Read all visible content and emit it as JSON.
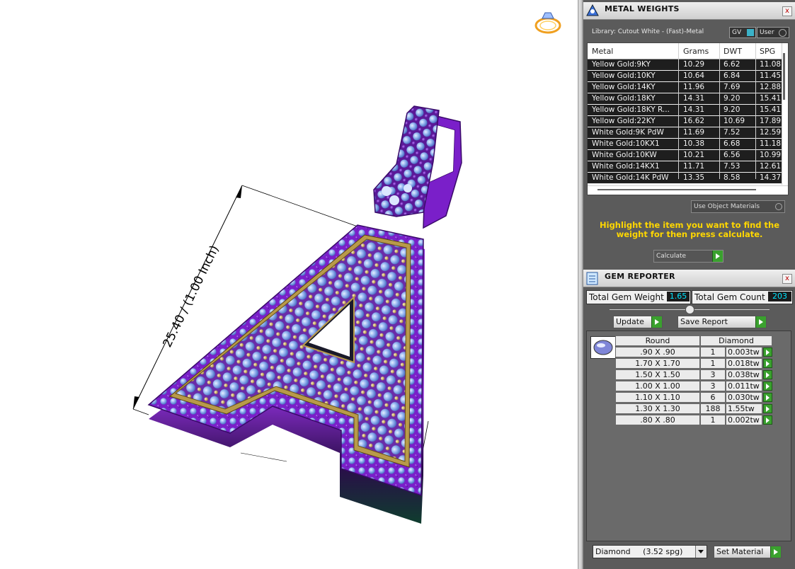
{
  "viewport": {
    "dimension_label": "25.40 / (1.00 Inch)"
  },
  "metal_weights": {
    "title": "METAL WEIGHTS",
    "close_label": "x",
    "library_label": "Library: Cutout White - (Fast)-Metal",
    "gv_label": "GV",
    "user_label": "User",
    "columns": [
      "Metal",
      "Grams",
      "DWT",
      "SPG"
    ],
    "rows": [
      [
        "Yellow Gold:9KY",
        "10.29",
        "6.62",
        "11.08"
      ],
      [
        "Yellow Gold:10KY",
        "10.64",
        "6.84",
        "11.45"
      ],
      [
        "Yellow Gold:14KY",
        "11.96",
        "7.69",
        "12.88"
      ],
      [
        "Yellow Gold:18KY",
        "14.31",
        "9.20",
        "15.41"
      ],
      [
        "Yellow Gold:18KY R...",
        "14.31",
        "9.20",
        "15.41"
      ],
      [
        "Yellow Gold:22KY",
        "16.62",
        "10.69",
        "17.89"
      ],
      [
        "White Gold:9K PdW",
        "11.69",
        "7.52",
        "12.59"
      ],
      [
        "White Gold:10KX1",
        "10.38",
        "6.68",
        "11.18"
      ],
      [
        "White Gold:10KW",
        "10.21",
        "6.56",
        "10.99"
      ],
      [
        "White Gold:14KX1",
        "11.71",
        "7.53",
        "12.61"
      ],
      [
        "White Gold:14K PdW",
        "13.35",
        "8.58",
        "14.37"
      ]
    ],
    "use_object_materials_label": "Use Object Materials",
    "instruction": "Highlight the item you want to find the weight for then press calculate.",
    "calculate_label": "Calculate"
  },
  "gem_reporter": {
    "title": "GEM REPORTER",
    "close_label": "x",
    "total_gem_weight_label": "Total Gem Weight",
    "total_gem_weight_value": "1.65",
    "total_gem_count_label": "Total Gem Count",
    "total_gem_count_value": "203",
    "update_label": "Update",
    "save_report_label": "Save Report",
    "shape_header": "Round",
    "material_header": "Diamond",
    "rows": [
      [
        ".90 X .90",
        "1",
        "0.003tw"
      ],
      [
        "1.70 X 1.70",
        "1",
        "0.018tw"
      ],
      [
        "1.50 X 1.50",
        "3",
        "0.038tw"
      ],
      [
        "1.00 X 1.00",
        "3",
        "0.011tw"
      ],
      [
        "1.10 X 1.10",
        "6",
        "0.030tw"
      ],
      [
        "1.30 X 1.30",
        "188",
        "1.55tw"
      ],
      [
        ".80 X .80",
        "1",
        "0.002tw"
      ]
    ],
    "material_select_value": "Diamond     (3.52 spg)",
    "set_material_label": "Set Material"
  },
  "colors": {
    "instruction_text": "#ffd700",
    "value_text": "#00e5ff",
    "pendant_purple": "#7a1fc9",
    "stone_blue": "#8fb3f0",
    "prong_gold": "#d7b563"
  }
}
